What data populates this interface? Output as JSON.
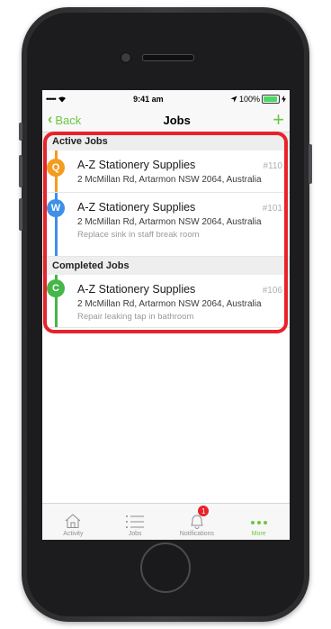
{
  "status_bar": {
    "signal_dots": "•••••",
    "time": "9:41 am",
    "battery_text": "100%"
  },
  "nav": {
    "back_label": "Back",
    "title": "Jobs",
    "add_symbol": "+"
  },
  "sections": {
    "active": {
      "header": "Active Jobs",
      "jobs": [
        {
          "badge": "Q",
          "color": "#f39c1f",
          "name": "A-Z Stationery Supplies",
          "number": "#110",
          "address": "2 McMillan Rd, Artarmon NSW 2064, Australia",
          "description": ""
        },
        {
          "badge": "W",
          "color": "#3f8fe8",
          "name": "A-Z Stationery Supplies",
          "number": "#101",
          "address": "2 McMillan Rd, Artarmon NSW 2064, Australia",
          "description": "Replace sink in staff break room"
        }
      ]
    },
    "completed": {
      "header": "Completed Jobs",
      "jobs": [
        {
          "badge": "C",
          "color": "#45b649",
          "name": "A-Z Stationery Supplies",
          "number": "#106",
          "address": "2 McMillan Rd, Artarmon NSW 2064, Australia",
          "description": "Repair leaking tap in bathroom"
        }
      ]
    }
  },
  "tabs": [
    {
      "label": "Activity",
      "icon": "home-icon"
    },
    {
      "label": "Jobs",
      "icon": "list-icon"
    },
    {
      "label": "Notifications",
      "icon": "bell-icon",
      "badge": "1"
    },
    {
      "label": "More",
      "icon": "more-icon",
      "active": true
    }
  ],
  "colors": {
    "accent": "#6cc644",
    "highlight": "#e8222b"
  }
}
